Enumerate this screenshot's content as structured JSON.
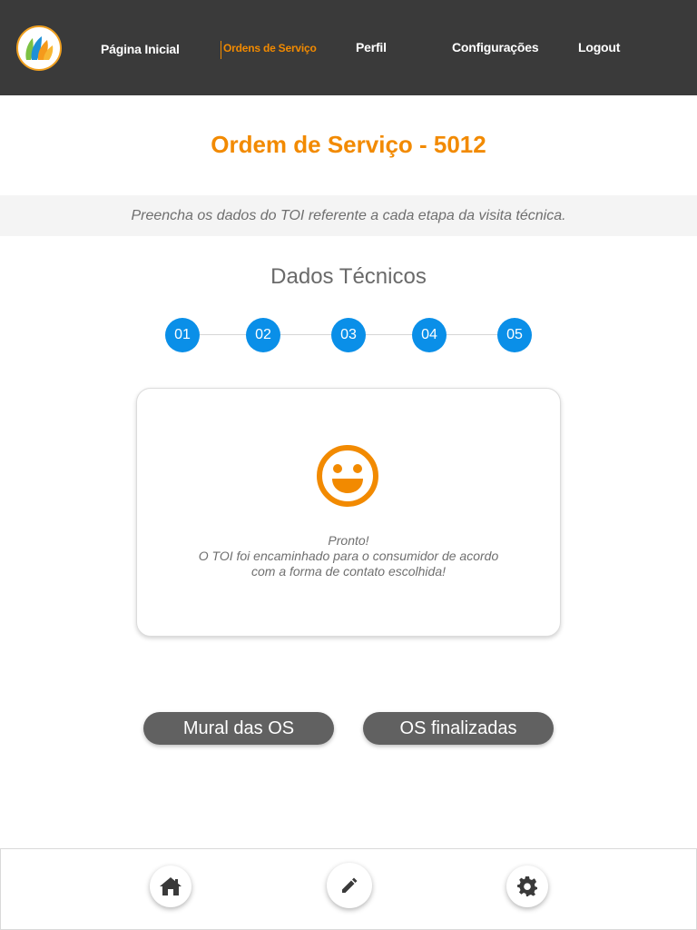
{
  "nav": {
    "items": [
      {
        "label": "Página Inicial"
      },
      {
        "label": "Ordens de Serviço",
        "active": true
      },
      {
        "label": "Perfil"
      },
      {
        "label": "Configurações"
      },
      {
        "label": "Logout"
      }
    ]
  },
  "header": {
    "title": "Ordem de Serviço - 5012",
    "subtitle": "Preencha os dados do TOI referente a cada etapa da visita técnica."
  },
  "section": {
    "title": "Dados Técnicos",
    "steps": [
      "01",
      "02",
      "03",
      "04",
      "05"
    ]
  },
  "card": {
    "icon": "smiley-icon",
    "lines": [
      "Pronto!",
      "O TOI foi encaminhado para o consumidor de acordo",
      "com a forma de contato escolhida!"
    ]
  },
  "actions": {
    "mural": "Mural das OS",
    "finalizadas": "OS finalizadas"
  },
  "bottom_nav": {
    "icons": [
      "home-icon",
      "edit-icon",
      "settings-icon"
    ]
  },
  "colors": {
    "accent": "#f28a00",
    "step": "#0a8fe8",
    "topbar": "#3a3a3a",
    "pill": "#616161"
  }
}
